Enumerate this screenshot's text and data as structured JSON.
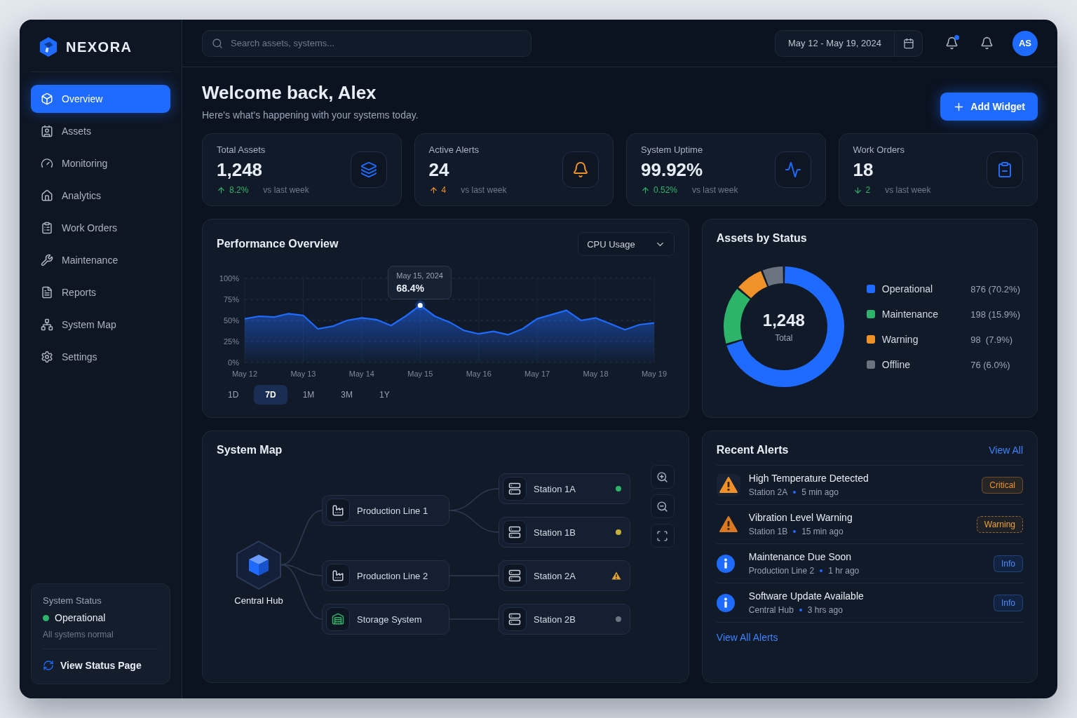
{
  "sidebar": {
    "logo": "NEXORA",
    "items": [
      {
        "label": "Overview",
        "selected": true
      },
      {
        "label": "Assets",
        "selected": false
      },
      {
        "label": "Monitoring",
        "selected": false
      },
      {
        "label": "Analytics",
        "selected": false
      },
      {
        "label": "Work Orders",
        "selected": false
      },
      {
        "label": "Maintenance",
        "selected": false
      },
      {
        "label": "Reports",
        "selected": false
      },
      {
        "label": "System Map",
        "selected": false
      },
      {
        "label": "Settings",
        "selected": false
      }
    ],
    "status_card": {
      "title": "System Status",
      "status": "Operational",
      "note": "All systems normal",
      "link": "View Status Page"
    }
  },
  "header": {
    "search": {
      "placeholder": "Search assets, systems..."
    },
    "date_range": "May 12 - May 19, 2024",
    "notifications": [
      {
        "unread": true
      },
      {
        "unread": false
      }
    ],
    "avatar": "AS"
  },
  "welcome": {
    "title": "Welcome back, Alex",
    "subtitle": "Here's what's happening with your systems today."
  },
  "add_widget": "Add Widget",
  "stats": [
    {
      "label": "Total Assets",
      "value": "1,248",
      "change": "8.2%",
      "increase": true,
      "favorable": true,
      "note": "vs last week"
    },
    {
      "label": "Active Alerts",
      "value": "24",
      "change": "4",
      "increase": true,
      "favorable": false,
      "note": "vs last week"
    },
    {
      "label": "System Uptime",
      "value": "99.92%",
      "change": "0.52%",
      "increase": true,
      "favorable": true,
      "note": "vs last week"
    },
    {
      "label": "Work Orders",
      "value": "18",
      "change": "2",
      "increase": false,
      "favorable": true,
      "note": "vs last week"
    }
  ],
  "performance": {
    "title": "Performance Overview",
    "metric": "CPU Usage",
    "tooltip_date": "May 15, 2024",
    "ranges": [
      {
        "label": "1D",
        "selected": false
      },
      {
        "label": "7D",
        "selected": true
      },
      {
        "label": "1M",
        "selected": false
      },
      {
        "label": "3M",
        "selected": false
      },
      {
        "label": "1Y",
        "selected": false
      }
    ],
    "chart_data": {
      "type": "area",
      "categories": [
        "May 12",
        null,
        null,
        null,
        "May 13",
        null,
        null,
        null,
        "May 14",
        null,
        null,
        null,
        "May 15",
        null,
        null,
        null,
        "May 16",
        null,
        null,
        null,
        "May 17",
        null,
        null,
        null,
        "May 18",
        null,
        null,
        null,
        "May 19"
      ],
      "series": [
        {
          "color": "#1f6bff",
          "values": [
            52,
            55,
            54,
            58,
            56,
            40,
            43,
            50,
            53,
            51,
            44,
            55,
            68,
            55,
            48,
            38,
            34,
            37,
            33,
            40,
            52,
            57,
            62,
            50,
            53,
            46,
            39,
            45,
            47
          ]
        }
      ],
      "ylim": [
        0,
        100
      ],
      "yticks": [
        {
          "value": 0,
          "label": "0%"
        },
        {
          "value": 25,
          "label": "25%"
        },
        {
          "value": 50,
          "label": "50%"
        },
        {
          "value": 75,
          "label": "75%"
        },
        {
          "value": 100,
          "label": "100%"
        }
      ],
      "grid": true,
      "annotations": [
        {
          "x": "May 15",
          "y": 68,
          "text": "68.4%"
        }
      ]
    }
  },
  "assets_by_status": {
    "title": "Assets by Status",
    "total": "1,248",
    "total_label": "Total",
    "chart_data": {
      "type": "donut",
      "categories": [
        "Operational",
        "Maintenance",
        "Warning",
        "Offline"
      ],
      "values": [
        70.2,
        15.9,
        7.9,
        6.0
      ]
    },
    "legend": [
      {
        "value": "876 (70.2%)",
        "color": "#1f6bff"
      },
      {
        "value": "198 (15.9%)",
        "color": "#2db36a"
      },
      {
        "value": "98  (7.9%)",
        "color": "#f0912a"
      },
      {
        "value": "76 (6.0%)",
        "color": "#6b7280"
      }
    ]
  },
  "system_map": {
    "title": "System Map",
    "hub": {
      "label": "Central Hub",
      "children": [
        {
          "label": "Production Line 1",
          "kind": "production",
          "children": [
            {
              "label": "Station 1A",
              "kind": "dot",
              "color": "#2db36a"
            },
            {
              "label": "Station 1B",
              "kind": "dot",
              "color": "#c9b03a"
            }
          ]
        },
        {
          "label": "Production Line 2",
          "kind": "production",
          "children": [
            {
              "label": "Station 2A",
              "kind": "warning",
              "color": "#e0a23a"
            }
          ]
        },
        {
          "label": "Storage System",
          "kind": "storage",
          "children": [
            {
              "label": "Station 2B",
              "kind": "dot",
              "color": "#6b7280"
            }
          ]
        }
      ]
    }
  },
  "recent_alerts": {
    "title": "Recent Alerts",
    "view_all": "View All",
    "items": [
      {
        "title": "High Temperature Detected",
        "source": "Station 2A",
        "time": "5 min ago",
        "kind": "critical",
        "badge": "Critical"
      },
      {
        "title": "Vibration Level Warning",
        "source": "Station 1B",
        "time": "15 min ago",
        "kind": "warning",
        "badge": "Warning"
      },
      {
        "title": "Maintenance Due Soon",
        "source": "Production Line 2",
        "time": "1 hr ago",
        "kind": "info",
        "badge": "Info"
      },
      {
        "title": "Software Update Available",
        "source": "Central Hub",
        "time": "3 hrs ago",
        "kind": "info",
        "badge": "Info"
      }
    ],
    "footer_link": "View All Alerts"
  }
}
